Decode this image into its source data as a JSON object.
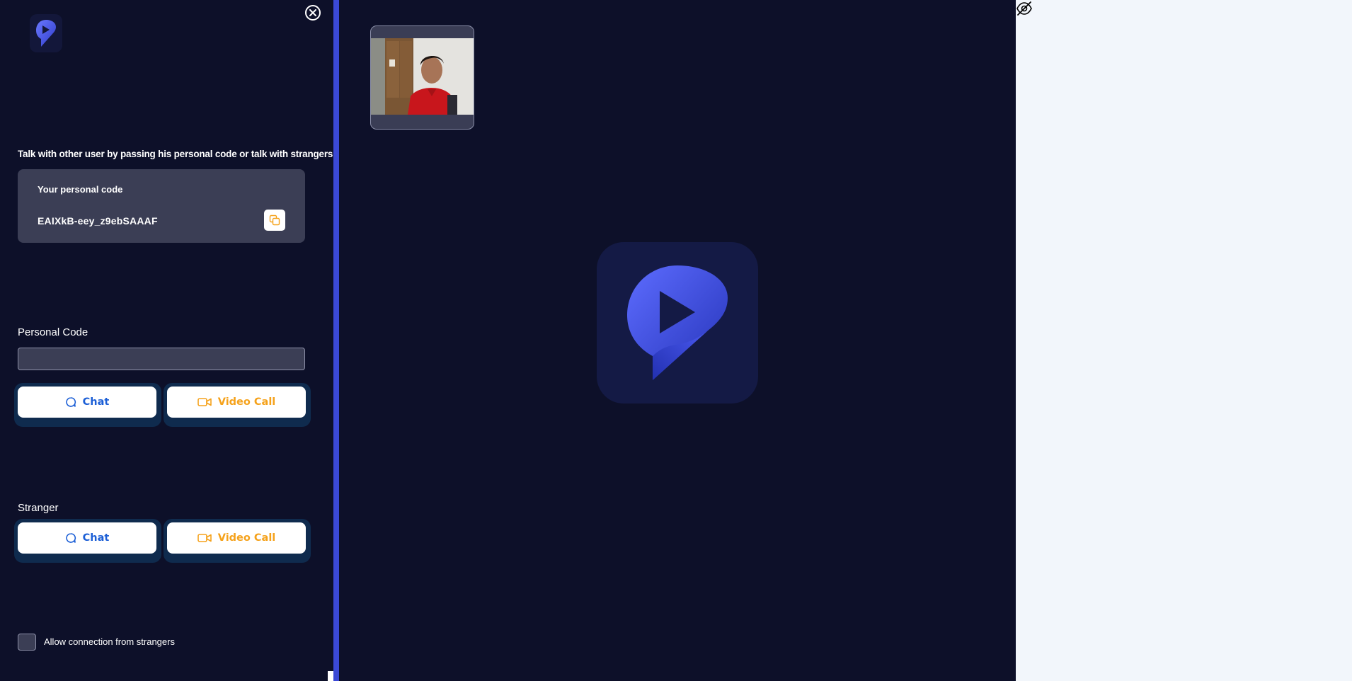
{
  "sidebar": {
    "intro_text": "Talk with other user by passing his personal code or talk with strangers!",
    "code_card": {
      "title": "Your personal code",
      "code": "EAIXkB-eey_z9ebSAAAF"
    },
    "personal_code": {
      "label": "Personal Code",
      "input_value": "",
      "input_placeholder": "",
      "chat_label": "Chat",
      "video_label": "Video Call"
    },
    "stranger": {
      "label": "Stranger",
      "chat_label": "Chat",
      "video_label": "Video Call"
    },
    "allow_strangers": {
      "label": "Allow connection from strangers",
      "checked": false
    }
  },
  "icons": {
    "close": "close-icon",
    "copy": "copy-icon",
    "chat": "chat-bubble-icon",
    "video": "video-camera-icon",
    "hide": "eye-off-icon",
    "logo": "app-logo"
  },
  "colors": {
    "background": "#0d1029",
    "card": "#3b3e55",
    "accent_blue": "#3b49d6",
    "chat_text": "#1c5fd6",
    "video_text": "#f5a21b",
    "right_panel": "#f2f6fb"
  }
}
